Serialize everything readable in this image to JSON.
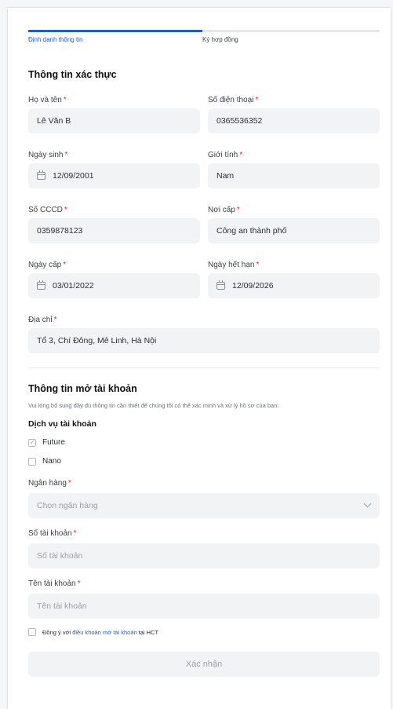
{
  "stepper": {
    "steps": [
      {
        "label": "Định danh thông tin",
        "active": true
      },
      {
        "label": "Ký hợp đồng",
        "active": false
      }
    ]
  },
  "verify": {
    "title": "Thông tin xác thực",
    "fullname": {
      "label": "Họ và tên",
      "value": "Lê Văn B"
    },
    "phone": {
      "label": "Số điện thoại",
      "value": "0365536352"
    },
    "dob": {
      "label": "Ngày sinh",
      "value": "12/09/2001"
    },
    "gender": {
      "label": "Giới tính",
      "value": "Nam"
    },
    "id_number": {
      "label": "Số CCCD",
      "value": "0359878123"
    },
    "issued_place": {
      "label": "Nơi cấp",
      "value": "Công an thành phố"
    },
    "issued_date": {
      "label": "Ngày cấp",
      "value": "03/01/2022"
    },
    "expiry_date": {
      "label": "Ngày hết hạn",
      "value": "12/09/2026"
    },
    "address": {
      "label": "Địa chỉ",
      "value": "Tổ 3, Chí Đông, Mê Linh, Hà Nội"
    }
  },
  "account": {
    "title": "Thông tin mở tài khoản",
    "description": "Vui lòng bổ sung đầy đủ thông tin cần thiết để chúng tôi có thể xác minh và xử lý hồ sơ của bạn.",
    "service_label": "Dịch vụ tài khoản",
    "services": [
      {
        "label": "Future",
        "checked": true
      },
      {
        "label": "Nano",
        "checked": false
      }
    ],
    "bank": {
      "label": "Ngân hàng",
      "placeholder": "Chọn ngân hàng"
    },
    "account_number": {
      "label": "Số tài khoản",
      "placeholder": "Số tài khoản"
    },
    "account_name": {
      "label": "Tên tài khoản",
      "placeholder": "Tên tài khoản"
    },
    "agree_prefix": "Đồng ý với",
    "agree_link": "điều khoản mở tài khoản",
    "agree_suffix": "tại HCT",
    "submit_label": "Xác nhận"
  },
  "required_mark": "*",
  "colors": {
    "accent": "#1f5fbf",
    "required": "#e02b2b",
    "field_bg": "#f2f3f5"
  }
}
